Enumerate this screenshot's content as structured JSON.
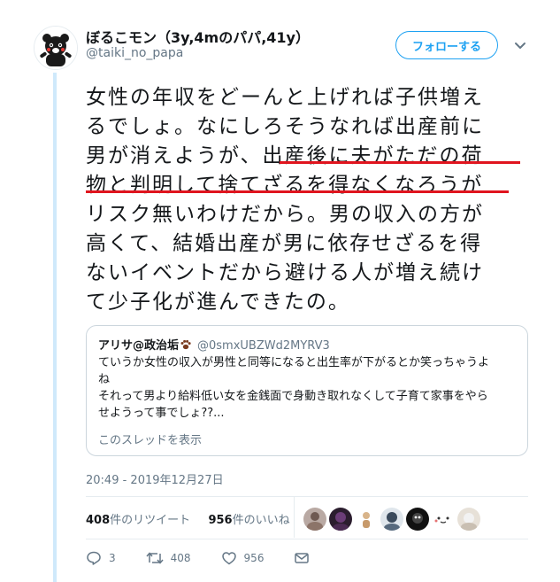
{
  "user": {
    "display_name": "ぼるこモン（3y,4mのパパ,41y）",
    "handle": "@taiki_no_papa",
    "avatar_icon": "bear-mascot-avatar"
  },
  "follow_button": {
    "label": "フォローする"
  },
  "tweet": {
    "lines": [
      "女性の年収をどーんと上げれば子供増え",
      "るでしょ。なにしろそうなれば出産前に",
      "男が消えようが、出産後に夫がただの荷",
      "物と判明して捨てざるを得なくなろうが",
      "リスク無いわけだから。男の収入の方が",
      "高くて、結婚出産が男に依存せざるを得",
      "ないイベントだから避ける人が増え続け",
      "て少子化が進んできたの。"
    ],
    "highlight_color": "#e0141e"
  },
  "quote": {
    "name": "アリサ@政治垢",
    "name_icon": "paw-print-icon",
    "handle": "@0smxUBZWd2MYRV3",
    "lines": [
      "ていうか女性の収入が男性と同等になると出生率が下がるとか笑っちゃうよ",
      "ね",
      "それって男より給料低い女を金銭面で身動き取れなくして子育て家事をやら",
      "せようって事でしょ??..."
    ],
    "thread_link": "このスレッドを表示"
  },
  "timestamp": "20:49 - 2019年12月27日",
  "stats": {
    "retweet_count": "408",
    "retweet_label": "件のリツイート",
    "like_count": "956",
    "like_label": "件のいいね"
  },
  "actions": {
    "reply_count": "3",
    "retweet_count": "408",
    "like_count": "956"
  },
  "colors": {
    "accent": "#1da1f2",
    "muted": "#657786",
    "text": "#14171a",
    "thread_line": "#cfe9fb"
  }
}
